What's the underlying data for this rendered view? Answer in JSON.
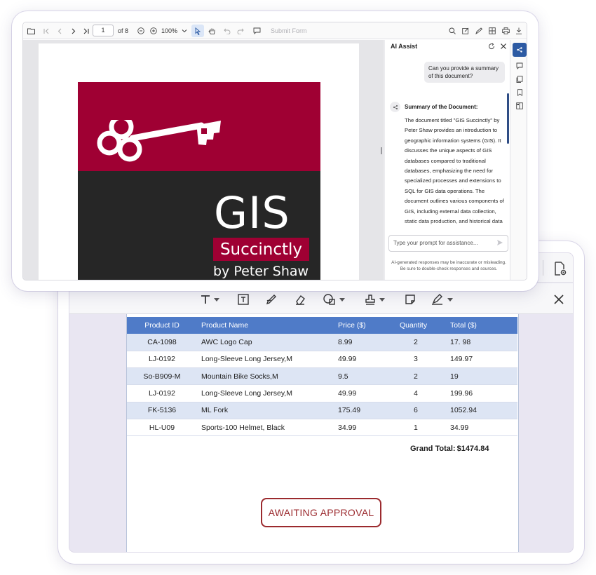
{
  "toolbar": {
    "page_number": "1",
    "page_count": "of 8",
    "zoom": "100%",
    "submit_form": "Submit Form"
  },
  "cover": {
    "title": "GIS",
    "series": "Succinctly",
    "author": "by Peter Shaw",
    "brand_color": "#9f0033",
    "dark_color": "#262626"
  },
  "ai_assist": {
    "title": "AI Assist",
    "user_question": "Can you provide a summary of this document?",
    "response_title": "Summary of the Document:",
    "response_text": "The document titled \"GIS Succinctly\" by Peter Shaw provides an introduction to geographic information systems (GIS). It discusses the unique aspects of GIS databases compared to traditional databases, emphasizing the need for specialized processes and extensions to SQL for GIS data operations. The document outlines various components of GIS, including external data collection, static data production, and historical data",
    "prompt_placeholder": "Type your prompt for assistance...",
    "disclaimer": "AI-generated responses may be inaccurate or misleading. Be sure to double-check responses and sources.",
    "accent_color": "#2c5aa3"
  },
  "invoice": {
    "headers": [
      "Product ID",
      "Product Name",
      "Price ($)",
      "Quantity",
      "Total ($)"
    ],
    "rows": [
      [
        "CA-1098",
        "AWC Logo Cap",
        "8.99",
        "2",
        "17. 98"
      ],
      [
        "LJ-0192",
        "Long-Sleeve Long Jersey,M",
        "49.99",
        "3",
        "149.97"
      ],
      [
        "So-B909-M",
        "Mountain Bike Socks,M",
        "9.5",
        "2",
        "19"
      ],
      [
        "LJ-0192",
        "Long-Sleeve Long Jersey,M",
        "49.99",
        "4",
        "199.96"
      ],
      [
        "FK-5136",
        "ML Fork",
        "175.49",
        "6",
        "1052.94"
      ],
      [
        "HL-U09",
        "Sports-100 Helmet, Black",
        "34.99",
        "1",
        "34.99"
      ]
    ],
    "grand_total_label": "Grand Total:",
    "grand_total_value": "$1474.84",
    "header_color": "#4f7bc8",
    "stripe_color": "#dde5f4"
  },
  "stamp": {
    "text": "AWAITING APPROVAL",
    "color": "#9b2a2e"
  }
}
